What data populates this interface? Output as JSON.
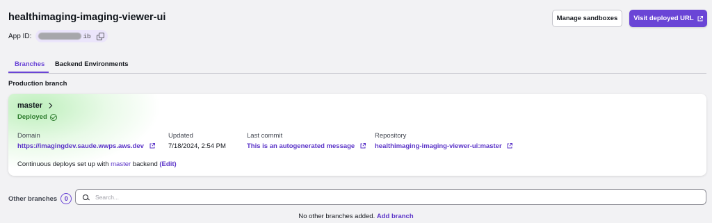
{
  "header": {
    "title": "healthimaging-imaging-viewer-ui",
    "app_id_label": "App ID:",
    "app_id_suffix": "ib",
    "manage_sandboxes": "Manage sandboxes",
    "visit_url": "Visit deployed URL"
  },
  "tabs": [
    {
      "label": "Branches",
      "active": true
    },
    {
      "label": "Backend Environments",
      "active": false
    }
  ],
  "production": {
    "section_label": "Production branch",
    "branch": "master",
    "status": "Deployed",
    "domain_label": "Domain",
    "domain_value": "https://imagingdev.saude.wwps.aws.dev",
    "updated_label": "Updated",
    "updated_value": "7/18/2024, 2:54 PM",
    "commit_label": "Last commit",
    "commit_value": "This is an autogenerated message",
    "repo_label": "Repository",
    "repo_value": "healthimaging-imaging-viewer-ui:master",
    "note_prefix": "Continuous deploys set up with",
    "note_branch": "master",
    "note_mid": "backend",
    "note_edit": "(Edit)"
  },
  "other": {
    "label": "Other branches",
    "count": "0",
    "search_placeholder": "Search...",
    "empty_text": "No other branches added.",
    "add_branch": "Add branch"
  },
  "colors": {
    "accent": "#6a45d6",
    "link": "#5b34c8",
    "success": "#2a7a2a",
    "background": "#f2f2f4"
  },
  "icons": [
    "copy-icon",
    "external-link-icon",
    "chevron-right-icon",
    "check-circle-icon",
    "search-icon"
  ]
}
